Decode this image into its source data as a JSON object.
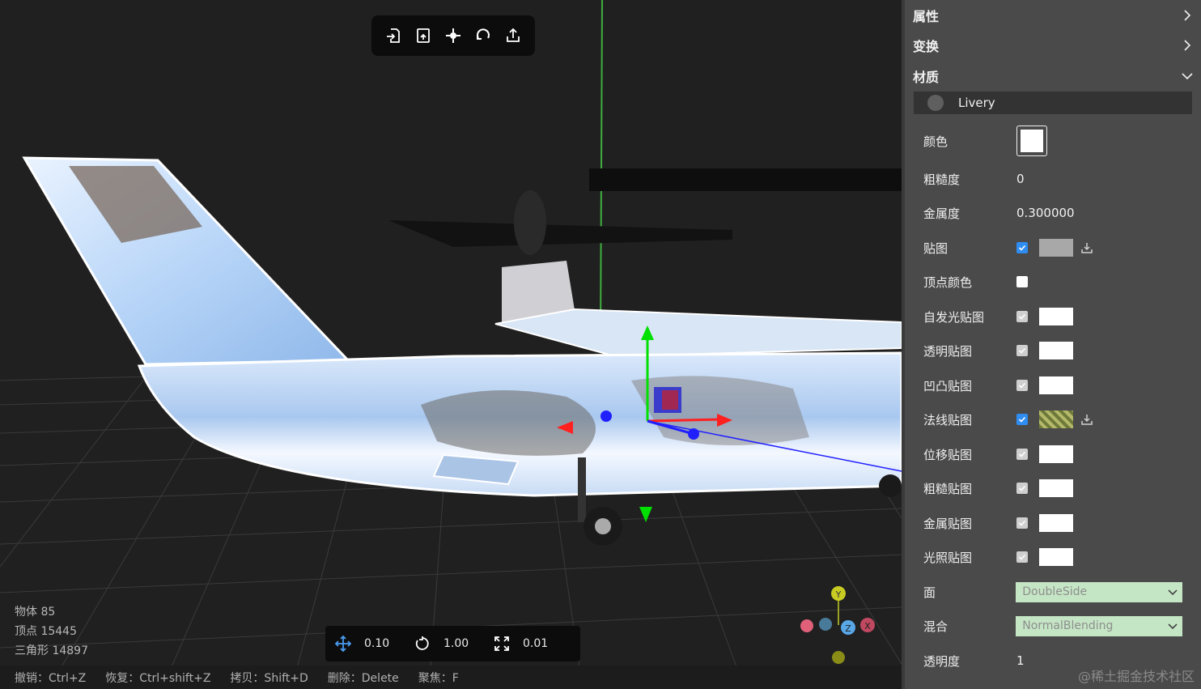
{
  "toolbar": {
    "icons": [
      "import-icon",
      "export-file-icon",
      "center-icon",
      "rotate-icon",
      "share-icon"
    ]
  },
  "stats": {
    "objects": "物体 85",
    "vertices": "顶点 15445",
    "triangles": "三角形 14897"
  },
  "snap": {
    "translate": "0.10",
    "rotate": "1.00",
    "scale": "0.01"
  },
  "shortcuts": {
    "undo": "撤销：Ctrl+Z",
    "redo": "恢复：Ctrl+shift+Z",
    "copy": "拷贝：Shift+D",
    "delete": "删除：Delete",
    "focus": "聚焦：F"
  },
  "panel": {
    "sections": {
      "properties": "属性",
      "transform": "变换",
      "material": "材质"
    },
    "material_name": "Livery",
    "color_label": "颜色",
    "roughness": {
      "label": "粗糙度",
      "value": "0"
    },
    "metalness": {
      "label": "金属度",
      "value": "0.300000"
    },
    "maps": [
      {
        "label": "贴图",
        "checked": true
      },
      {
        "label": "顶点颜色",
        "checked": false
      },
      {
        "label": "自发光贴图",
        "checked": false
      },
      {
        "label": "透明贴图",
        "checked": false
      },
      {
        "label": "凹凸贴图",
        "checked": false
      },
      {
        "label": "法线贴图",
        "checked": true
      },
      {
        "label": "位移贴图",
        "checked": false
      },
      {
        "label": "粗糙贴图",
        "checked": false
      },
      {
        "label": "金属贴图",
        "checked": false
      },
      {
        "label": "光照贴图",
        "checked": false
      }
    ],
    "side": {
      "label": "面",
      "value": "DoubleSide"
    },
    "blending": {
      "label": "混合",
      "value": "NormalBlending"
    },
    "opacity": {
      "label": "透明度",
      "value": "1"
    }
  },
  "watermark": "@稀土掘金技术社区",
  "colors": {
    "panel_bg": "#4a4a4a",
    "accent_blue": "#2f8cf0",
    "select_bg": "#c5e6c5"
  }
}
